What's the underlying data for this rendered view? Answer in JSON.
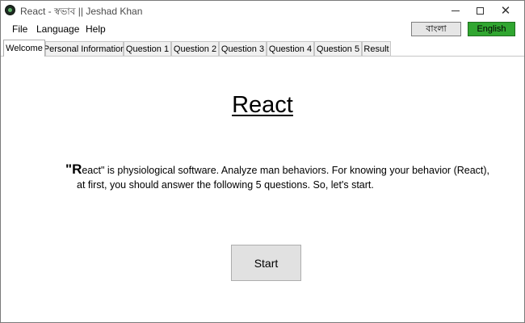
{
  "window": {
    "title": "React - স্বভাব || Jeshad Khan",
    "controls": {
      "minimize": "minimize",
      "maximize": "maximize",
      "close": "✕"
    }
  },
  "menu": {
    "items": [
      "File",
      "Language",
      "Help"
    ]
  },
  "language_buttons": {
    "bangla": "বাংলা",
    "english": "English",
    "english_color": "#30a630"
  },
  "tabs": [
    {
      "label": "Welcome",
      "active": true
    },
    {
      "label": "Personal Information",
      "active": false
    },
    {
      "label": "Question 1",
      "active": false
    },
    {
      "label": "Question 2",
      "active": false
    },
    {
      "label": "Question 3",
      "active": false
    },
    {
      "label": "Question 4",
      "active": false
    },
    {
      "label": "Question 5",
      "active": false
    },
    {
      "label": "Result",
      "active": false
    }
  ],
  "welcome": {
    "heading": "React",
    "intro_quote_open": "\"",
    "intro_initial": "R",
    "intro_line1_rest": "eact\" is physiological software. Analyze man behaviors. For knowing your behavior (React),",
    "intro_line2": "at first, you should answer the following 5 questions. So, let's start.",
    "start_button": "Start"
  }
}
